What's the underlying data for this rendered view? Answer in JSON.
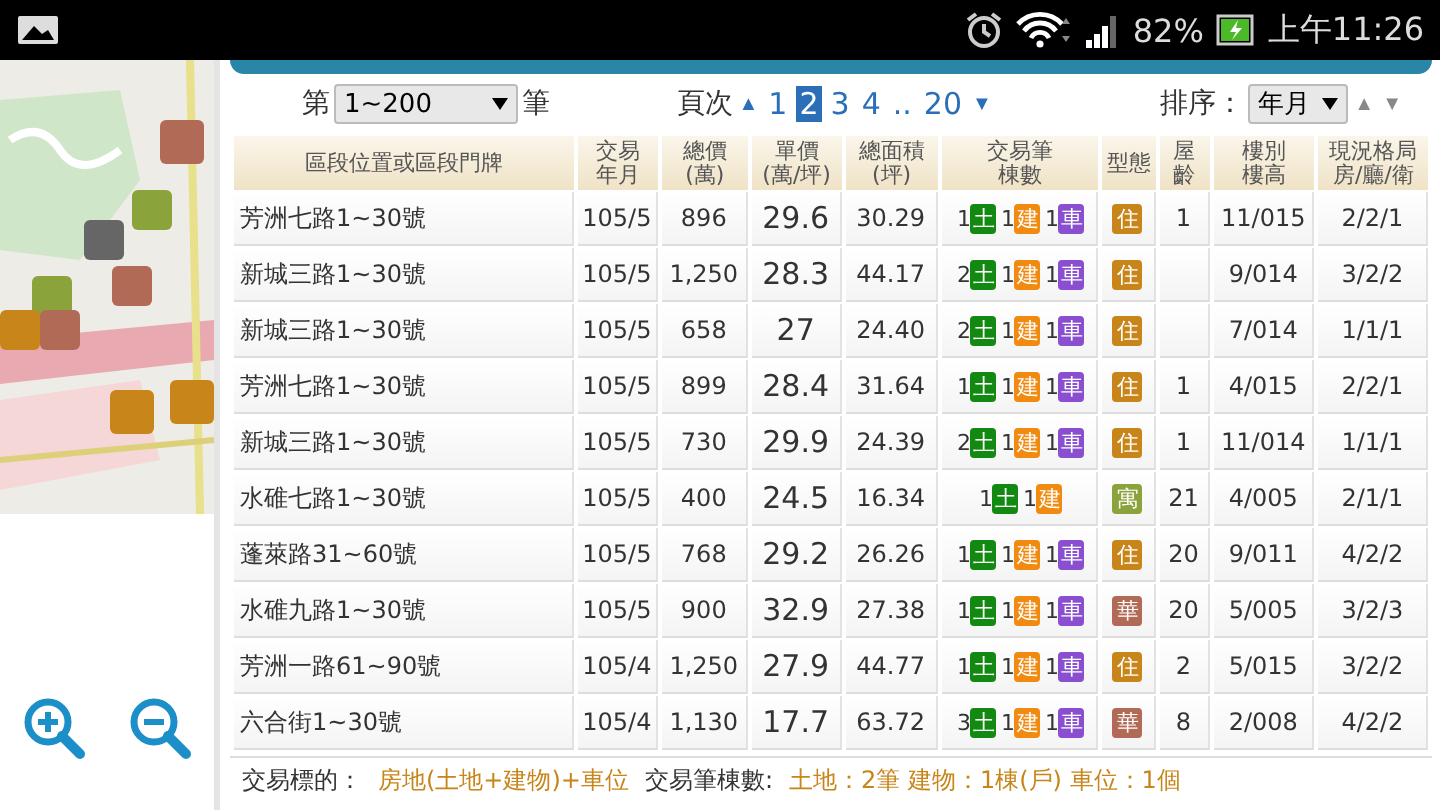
{
  "status_bar": {
    "battery": "82%",
    "time": "上午11:26"
  },
  "controls": {
    "range_prefix": "第",
    "range_value": "1~200",
    "range_suffix": "筆",
    "pages_label": "頁次",
    "page_prev": "▲",
    "pages": [
      {
        "label": "1",
        "selected": false
      },
      {
        "label": "2",
        "selected": true
      },
      {
        "label": "3",
        "selected": false
      },
      {
        "label": "4",
        "selected": false
      },
      {
        "label": "..",
        "selected": false
      },
      {
        "label": "20",
        "selected": false
      }
    ],
    "page_next": "▼",
    "sort_label": "排序：",
    "sort_value": "年月",
    "sort_up": "▲",
    "sort_down": "▼"
  },
  "table": {
    "columns": [
      "區段位置或區段門牌",
      "交易年月",
      "總價\n(萬)",
      "單價\n(萬/坪)",
      "總面積\n(坪)",
      "交易筆棟數",
      "型態",
      "屋齡",
      "樓別樓高",
      "現況格局房/廳/衛"
    ],
    "rows": [
      {
        "address": "芳洲七路1~30號",
        "date": "105/5",
        "total": "896",
        "unit": "29.6",
        "area": "30.29",
        "trades": [
          {
            "kind": "land",
            "count": "1",
            "label": "土"
          },
          {
            "kind": "building",
            "count": "1",
            "label": "建"
          },
          {
            "kind": "parking",
            "count": "1",
            "label": "車"
          }
        ],
        "type": {
          "label": "住",
          "color": "#c8861a"
        },
        "age": "1",
        "floor": "11/015",
        "layout": "2/2/1"
      },
      {
        "address": "新城三路1~30號",
        "date": "105/5",
        "total": "1,250",
        "unit": "28.3",
        "area": "44.17",
        "trades": [
          {
            "kind": "land",
            "count": "2",
            "label": "土"
          },
          {
            "kind": "building",
            "count": "1",
            "label": "建"
          },
          {
            "kind": "parking",
            "count": "1",
            "label": "車"
          }
        ],
        "type": {
          "label": "住",
          "color": "#c8861a"
        },
        "age": "",
        "floor": "9/014",
        "layout": "3/2/2"
      },
      {
        "address": "新城三路1~30號",
        "date": "105/5",
        "total": "658",
        "unit": "27",
        "area": "24.40",
        "trades": [
          {
            "kind": "land",
            "count": "2",
            "label": "土"
          },
          {
            "kind": "building",
            "count": "1",
            "label": "建"
          },
          {
            "kind": "parking",
            "count": "1",
            "label": "車"
          }
        ],
        "type": {
          "label": "住",
          "color": "#c8861a"
        },
        "age": "",
        "floor": "7/014",
        "layout": "1/1/1"
      },
      {
        "address": "芳洲七路1~30號",
        "date": "105/5",
        "total": "899",
        "unit": "28.4",
        "area": "31.64",
        "trades": [
          {
            "kind": "land",
            "count": "1",
            "label": "土"
          },
          {
            "kind": "building",
            "count": "1",
            "label": "建"
          },
          {
            "kind": "parking",
            "count": "1",
            "label": "車"
          }
        ],
        "type": {
          "label": "住",
          "color": "#c8861a"
        },
        "age": "1",
        "floor": "4/015",
        "layout": "2/2/1"
      },
      {
        "address": "新城三路1~30號",
        "date": "105/5",
        "total": "730",
        "unit": "29.9",
        "area": "24.39",
        "trades": [
          {
            "kind": "land",
            "count": "2",
            "label": "土"
          },
          {
            "kind": "building",
            "count": "1",
            "label": "建"
          },
          {
            "kind": "parking",
            "count": "1",
            "label": "車"
          }
        ],
        "type": {
          "label": "住",
          "color": "#c8861a"
        },
        "age": "1",
        "floor": "11/014",
        "layout": "1/1/1"
      },
      {
        "address": "水碓七路1~30號",
        "date": "105/5",
        "total": "400",
        "unit": "24.5",
        "area": "16.34",
        "trades": [
          {
            "kind": "land",
            "count": "1",
            "label": "土"
          },
          {
            "kind": "building",
            "count": "1",
            "label": "建"
          }
        ],
        "type": {
          "label": "寓",
          "color": "#8aa33a"
        },
        "age": "21",
        "floor": "4/005",
        "layout": "2/1/1"
      },
      {
        "address": "蓬萊路31~60號",
        "date": "105/5",
        "total": "768",
        "unit": "29.2",
        "area": "26.26",
        "trades": [
          {
            "kind": "land",
            "count": "1",
            "label": "土"
          },
          {
            "kind": "building",
            "count": "1",
            "label": "建"
          },
          {
            "kind": "parking",
            "count": "1",
            "label": "車"
          }
        ],
        "type": {
          "label": "住",
          "color": "#c8861a"
        },
        "age": "20",
        "floor": "9/011",
        "layout": "4/2/2"
      },
      {
        "address": "水碓九路1~30號",
        "date": "105/5",
        "total": "900",
        "unit": "32.9",
        "area": "27.38",
        "trades": [
          {
            "kind": "land",
            "count": "1",
            "label": "土"
          },
          {
            "kind": "building",
            "count": "1",
            "label": "建"
          },
          {
            "kind": "parking",
            "count": "1",
            "label": "車"
          }
        ],
        "type": {
          "label": "華",
          "color": "#b06a55"
        },
        "age": "20",
        "floor": "5/005",
        "layout": "3/2/3"
      },
      {
        "address": "芳洲一路61~90號",
        "date": "105/4",
        "total": "1,250",
        "unit": "27.9",
        "area": "44.77",
        "trades": [
          {
            "kind": "land",
            "count": "1",
            "label": "土"
          },
          {
            "kind": "building",
            "count": "1",
            "label": "建"
          },
          {
            "kind": "parking",
            "count": "1",
            "label": "車"
          }
        ],
        "type": {
          "label": "住",
          "color": "#c8861a"
        },
        "age": "2",
        "floor": "5/015",
        "layout": "3/2/2"
      },
      {
        "address": "六合街1~30號",
        "date": "105/4",
        "total": "1,130",
        "unit": "17.7",
        "area": "63.72",
        "trades": [
          {
            "kind": "land",
            "count": "3",
            "label": "土"
          },
          {
            "kind": "building",
            "count": "1",
            "label": "建"
          },
          {
            "kind": "parking",
            "count": "1",
            "label": "車"
          }
        ],
        "type": {
          "label": "華",
          "color": "#b06a55"
        },
        "age": "8",
        "floor": "2/008",
        "layout": "4/2/2"
      }
    ]
  },
  "details": [
    {
      "label": "交易標的：",
      "value": "房地(土地+建物)+車位"
    },
    {
      "label": "交易筆棟數:",
      "value": "土地：2筆 建物：1棟(戶) 車位：1個"
    }
  ]
}
